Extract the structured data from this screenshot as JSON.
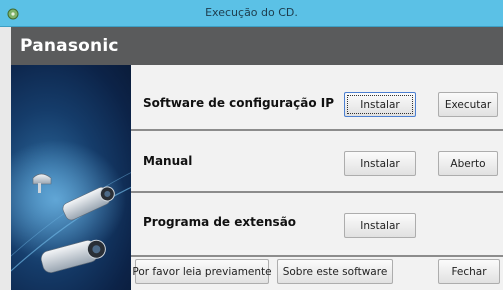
{
  "window": {
    "title": "Execução do CD."
  },
  "brand": {
    "name": "Panasonic"
  },
  "rows": [
    {
      "label": "Software de configuração IP",
      "install": "Instalar",
      "action": "Executar"
    },
    {
      "label": "Manual",
      "install": "Instalar",
      "action": "Aberto"
    },
    {
      "label": "Programa de extensão",
      "install": "Instalar"
    }
  ],
  "footer": {
    "read_first": "Por favor leia previamente",
    "about": "Sobre este software",
    "close": "Fechar"
  },
  "colors": {
    "titlebar": "#5bc1e6",
    "brandbar": "#5a5b5c",
    "side_panel": "#153c6a"
  }
}
